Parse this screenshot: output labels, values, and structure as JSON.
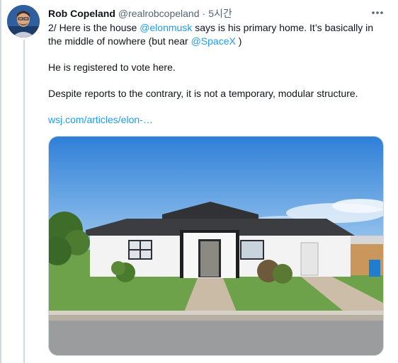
{
  "tweet": {
    "author_name": "Rob Copeland",
    "handle": "@realrobcopeland",
    "separator": "·",
    "time": "5시간",
    "text": {
      "line1_prefix": "2/ Here is the house ",
      "mention_elon": "@elonmusk",
      "line1_suffix": " says is his primary home. It’s basically in the middle of nowhere (but near ",
      "mention_spacex": "@SpaceX",
      "line1_end": " )",
      "para2": "He is registered to vote here.",
      "para3": "Despite reports to the contrary, it is not a temporary, modular structure.",
      "link": "wsj.com/articles/elon-…"
    },
    "icons": {
      "more": "more-horizontal-icon",
      "avatar": "user-avatar"
    },
    "colors": {
      "link": "#1d9bf0",
      "secondary_text": "#536471",
      "border": "#cfd9de"
    }
  }
}
